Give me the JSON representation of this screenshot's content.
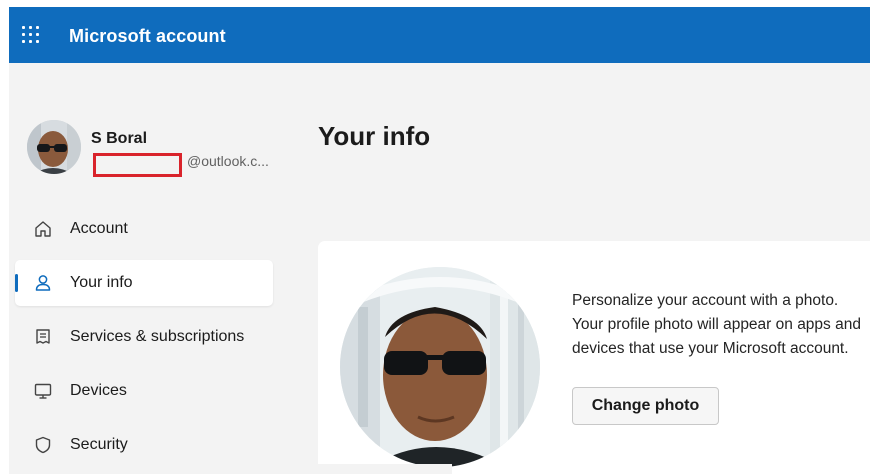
{
  "header": {
    "app_title": "Microsoft account",
    "menu_icon": "app-launcher-waffle-icon",
    "brand_color": "#0f6cbd"
  },
  "profile": {
    "name": "S Boral",
    "email_suffix": "@outlook.c..."
  },
  "sidebar": {
    "items": [
      {
        "label": "Account",
        "icon": "home-icon",
        "active": false
      },
      {
        "label": "Your info",
        "icon": "person-icon",
        "active": true
      },
      {
        "label": "Services & subscriptions",
        "icon": "receipt-icon",
        "active": false
      },
      {
        "label": "Devices",
        "icon": "monitor-icon",
        "active": false
      },
      {
        "label": "Security",
        "icon": "shield-icon",
        "active": false
      }
    ]
  },
  "main": {
    "title": "Your info",
    "photo_card": {
      "description": "Personalize your account with a photo. Your profile photo will appear on apps and devices that use your Microsoft account.",
      "button_label": "Change photo"
    }
  },
  "colors": {
    "accent": "#0f6cbd",
    "redaction": "#d9232b",
    "page_background": "#f3f3f3"
  }
}
